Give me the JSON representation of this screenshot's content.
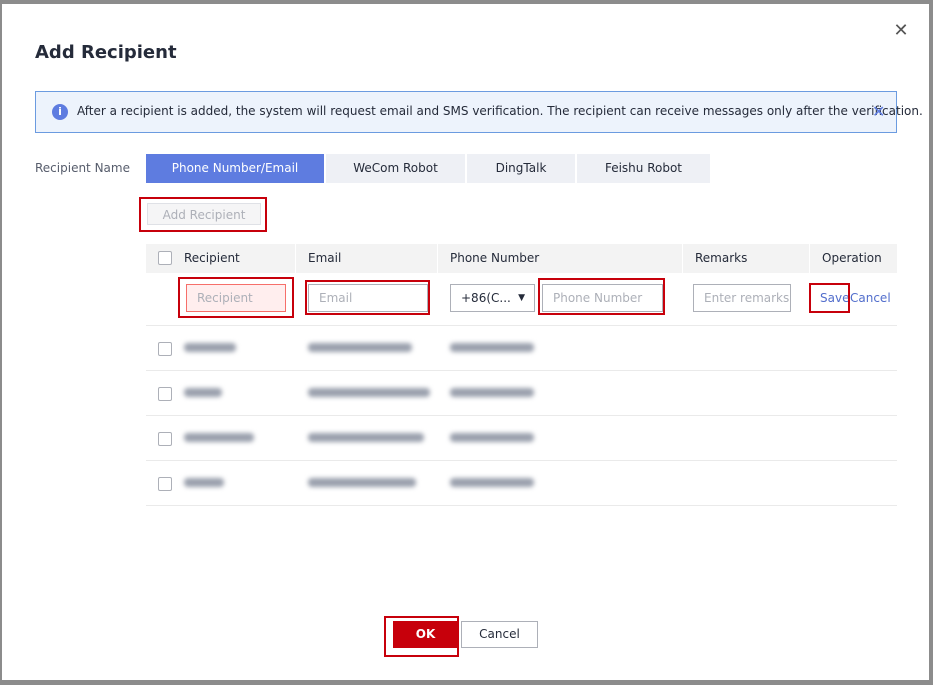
{
  "dialog": {
    "title": "Add Recipient",
    "close_icon": "close-icon"
  },
  "notice": {
    "icon": "info-icon",
    "text": "After a recipient is added, the system will request email and SMS verification. The recipient can receive messages only after the verification.",
    "close_icon": "close-icon"
  },
  "form": {
    "recipient_name_label": "Recipient Name",
    "tabs": [
      {
        "label": "Phone Number/Email",
        "active": true
      },
      {
        "label": "WeCom Robot",
        "active": false
      },
      {
        "label": "DingTalk",
        "active": false
      },
      {
        "label": "Feishu Robot",
        "active": false
      }
    ],
    "add_recipient_label": "Add Recipient"
  },
  "table": {
    "headers": [
      "Recipient",
      "Email",
      "Phone Number",
      "Remarks",
      "Operation"
    ],
    "edit_row": {
      "recipient_placeholder": "Recipient",
      "email_placeholder": "Email",
      "country_code": "+86(C...",
      "phone_placeholder": "Phone Number",
      "remarks_placeholder": "Enter remarks",
      "save_label": "Save",
      "cancel_label": "Cancel"
    },
    "blurred_rows": 4
  },
  "footer": {
    "ok_label": "OK",
    "cancel_label": "Cancel"
  },
  "colors": {
    "primary": "#5e7ce0",
    "danger": "#c7000b",
    "link": "#526ecc"
  }
}
